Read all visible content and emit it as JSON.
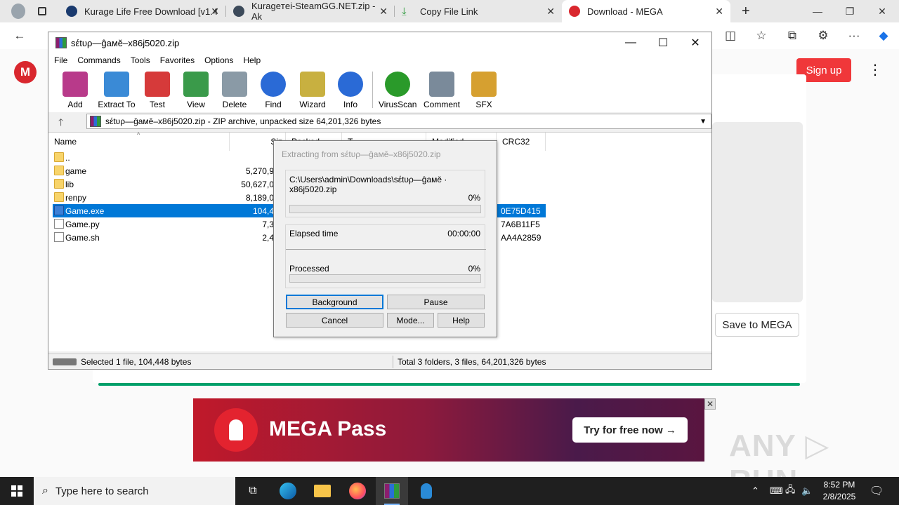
{
  "browser": {
    "tabs": [
      {
        "title": "Kurage Life Free Download [v1.4",
        "favicon_color": "#1a3a6e"
      },
      {
        "title": "Kurageтei-SteamGG.NET.zip - Ak",
        "favicon_color": "#3c4a5a"
      },
      {
        "title": "Copy File Link",
        "favicon_color": "#2e9a3d"
      },
      {
        "title": "Download - MEGA",
        "favicon_color": "#d9272e"
      }
    ],
    "new_tab": "+",
    "nav": {
      "back": "←"
    }
  },
  "mega": {
    "logo": "M",
    "signup": "Sign up",
    "menu": "⋮",
    "save_to_mega": "Save to MEGA",
    "ad": {
      "title": "MEGA Pass",
      "cta": "Try for free now  →",
      "close": "✕"
    },
    "watermark": "ANY ▷ RUN"
  },
  "winrar": {
    "title": "sέtυρ—ĝaмě–x86j5020.zip",
    "menu": [
      "File",
      "Commands",
      "Tools",
      "Favorites",
      "Options",
      "Help"
    ],
    "toolbar": [
      {
        "label": "Add",
        "color": "#b83a8a"
      },
      {
        "label": "Extract To",
        "color": "#3a8ad6"
      },
      {
        "label": "Test",
        "color": "#d63a3a"
      },
      {
        "label": "View",
        "color": "#3a9a4a"
      },
      {
        "label": "Delete",
        "color": "#8a9aa6"
      },
      {
        "label": "Find",
        "color": "#2a6ad6"
      },
      {
        "label": "Wizard",
        "color": "#c8b040"
      },
      {
        "label": "Info",
        "color": "#2a6ad6"
      },
      {
        "label": "VirusScan",
        "color": "#2a9a2a"
      },
      {
        "label": "Comment",
        "color": "#7a8a9a"
      },
      {
        "label": "SFX",
        "color": "#d6a030"
      }
    ],
    "path": "sέtυρ—ĝaмě–x86j5020.zip - ZIP archive, unpacked size 64,201,326 bytes",
    "columns": {
      "name": "Name",
      "size": "Siz",
      "packed": "Packed",
      "type": "T",
      "modified": "Modified",
      "crc": "CRC32"
    },
    "files": [
      {
        "name": "..",
        "size": "",
        "crc": "",
        "kind": "folder"
      },
      {
        "name": "game",
        "size": "5,270,9",
        "crc": "",
        "kind": "folder"
      },
      {
        "name": "lib",
        "size": "50,627,0",
        "crc": "",
        "kind": "folder"
      },
      {
        "name": "renpy",
        "size": "8,189,0",
        "crc": "",
        "kind": "folder"
      },
      {
        "name": "Game.exe",
        "size": "104,4",
        "crc": "0E75D415",
        "kind": "exe"
      },
      {
        "name": "Game.py",
        "size": "7,3",
        "crc": "7A6B11F5",
        "kind": "file"
      },
      {
        "name": "Game.sh",
        "size": "2,4",
        "crc": "AA4A2859",
        "kind": "file"
      }
    ],
    "status_left": "Selected 1 file, 104,448 bytes",
    "status_right": "Total 3 folders, 3 files, 64,201,326 bytes"
  },
  "extract_dialog": {
    "title": "Extracting from sέtυρ—ĝaмě–x86j5020.zip",
    "path": "C:\\Users\\admin\\Downloads\\sέtυρ—ĝaмě · x86j5020.zip",
    "file_percent": "0%",
    "file_progress": 0,
    "elapsed_label": "Elapsed time",
    "elapsed_value": "00:00:00",
    "processed_label": "Processed",
    "processed_percent": "0%",
    "processed_progress": 0,
    "buttons": {
      "background": "Background",
      "pause": "Pause",
      "cancel": "Cancel",
      "mode": "Mode...",
      "help": "Help"
    }
  },
  "taskbar": {
    "search_placeholder": "Type here to search",
    "time": "8:52 PM",
    "date": "2/8/2025"
  }
}
